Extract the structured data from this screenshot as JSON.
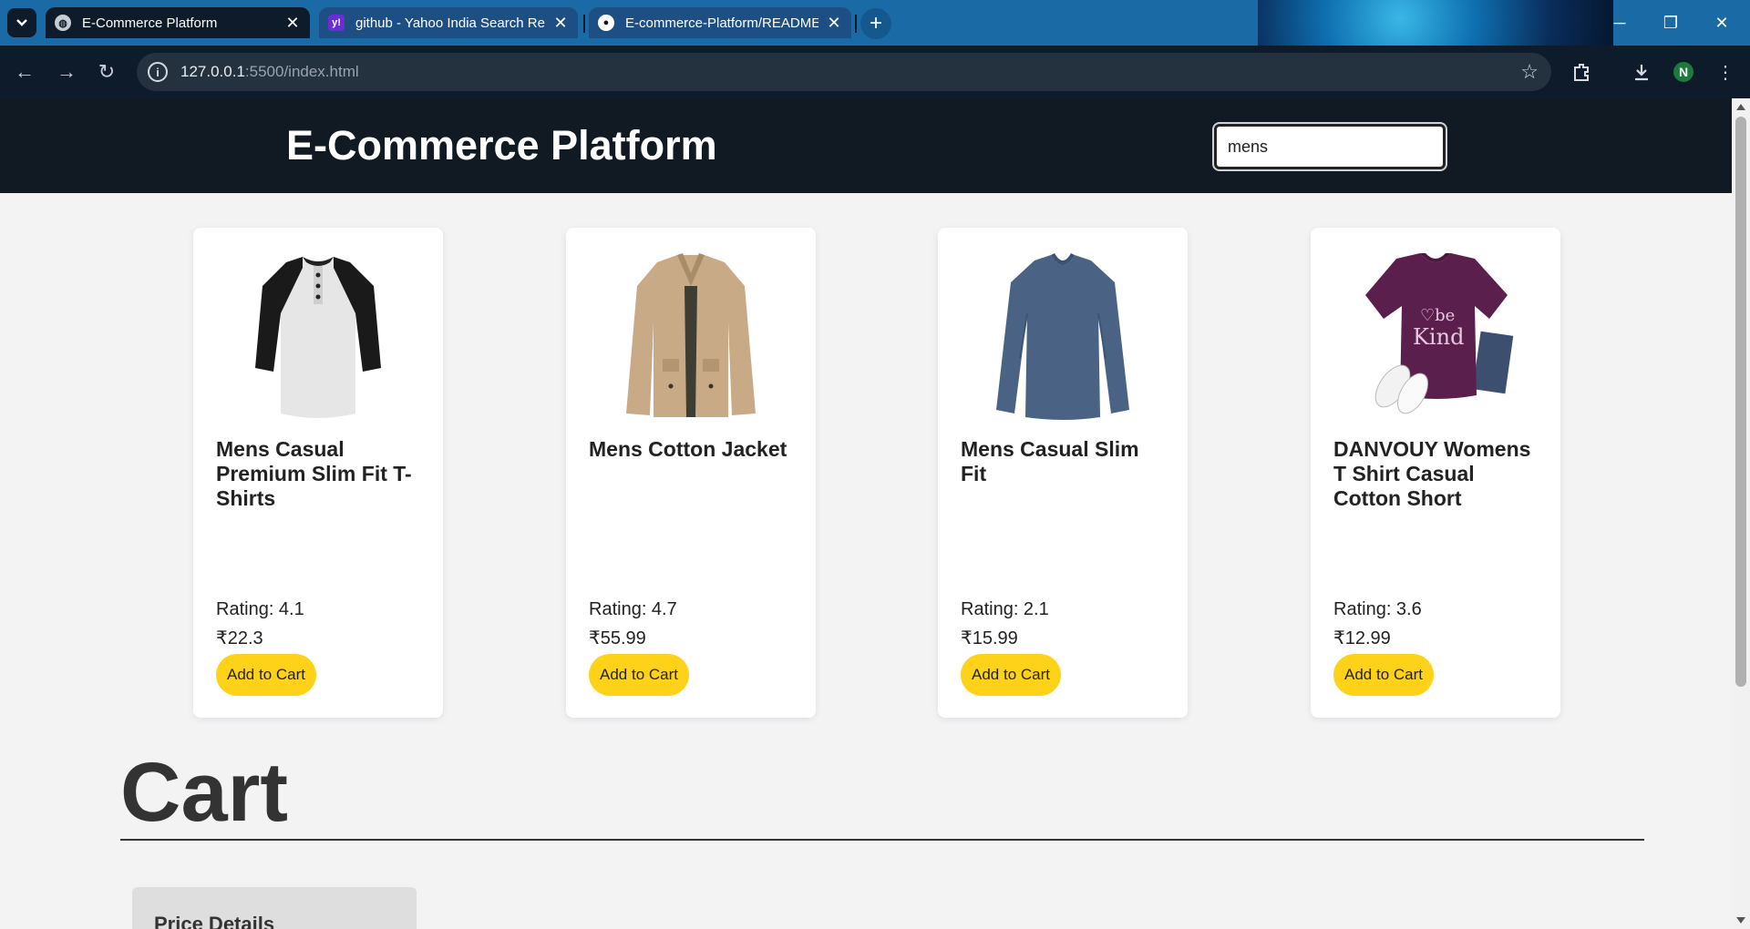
{
  "browser": {
    "tabs": [
      {
        "title": "E-Commerce Platform",
        "icon": "globe-icon",
        "active": true
      },
      {
        "title": "github - Yahoo India Search Res",
        "icon": "yahoo-icon",
        "active": false
      },
      {
        "title": "E-commerce-Platform/README",
        "icon": "github-icon",
        "active": false
      }
    ],
    "url_host": "127.0.0.1",
    "url_rest": ":5500/index.html",
    "profile_initial": "N"
  },
  "header": {
    "title": "E-Commerce Platform",
    "search_value": "mens"
  },
  "products": [
    {
      "name": "Mens Casual Premium Slim Fit T-Shirts",
      "rating": "Rating: 4.1",
      "price": "₹22.3",
      "button": "Add to Cart",
      "image": "raglan-tshirt"
    },
    {
      "name": "Mens Cotton Jacket",
      "rating": "Rating: 4.7",
      "price": "₹55.99",
      "button": "Add to Cart",
      "image": "cotton-jacket"
    },
    {
      "name": "Mens Casual Slim Fit",
      "rating": "Rating: 2.1",
      "price": "₹15.99",
      "button": "Add to Cart",
      "image": "longsleeve-shirt"
    },
    {
      "name": "DANVOUY Womens T Shirt Casual Cotton Short",
      "rating": "Rating: 3.6",
      "price": "₹12.99",
      "button": "Add to Cart",
      "image": "purple-tshirt"
    }
  ],
  "cart": {
    "heading": "Cart",
    "price_details": "Price Details"
  },
  "colors": {
    "header_bg": "#111a22",
    "button_bg": "#ffd21a",
    "page_bg": "#f3f3f4"
  }
}
